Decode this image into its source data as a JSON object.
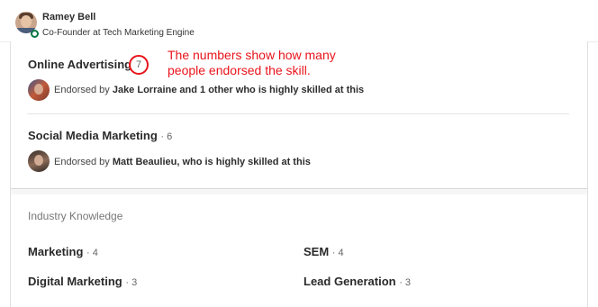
{
  "profile": {
    "name": "Ramey Bell",
    "headline": "Co-Founder at Tech Marketing Engine",
    "status_color": "#057642"
  },
  "annotation": {
    "text": "The numbers show how many people endorsed the skill.",
    "color": "#e8141b"
  },
  "top_skills": [
    {
      "name": "Online Advertising",
      "count": "7",
      "endorsed_prefix": "Endorsed by ",
      "endorsed_by": "Jake Lorraine and 1 other who is highly skilled at this"
    },
    {
      "name": "Social Media Marketing",
      "count": "· 6",
      "endorsed_prefix": "Endorsed by ",
      "endorsed_by": "Matt Beaulieu, who is highly skilled at this"
    }
  ],
  "industry": {
    "title": "Industry Knowledge",
    "skills": [
      {
        "name": "Marketing",
        "count": "· 4"
      },
      {
        "name": "SEM",
        "count": "· 4"
      },
      {
        "name": "Digital Marketing",
        "count": "· 3"
      },
      {
        "name": "Lead Generation",
        "count": "· 3"
      }
    ]
  }
}
